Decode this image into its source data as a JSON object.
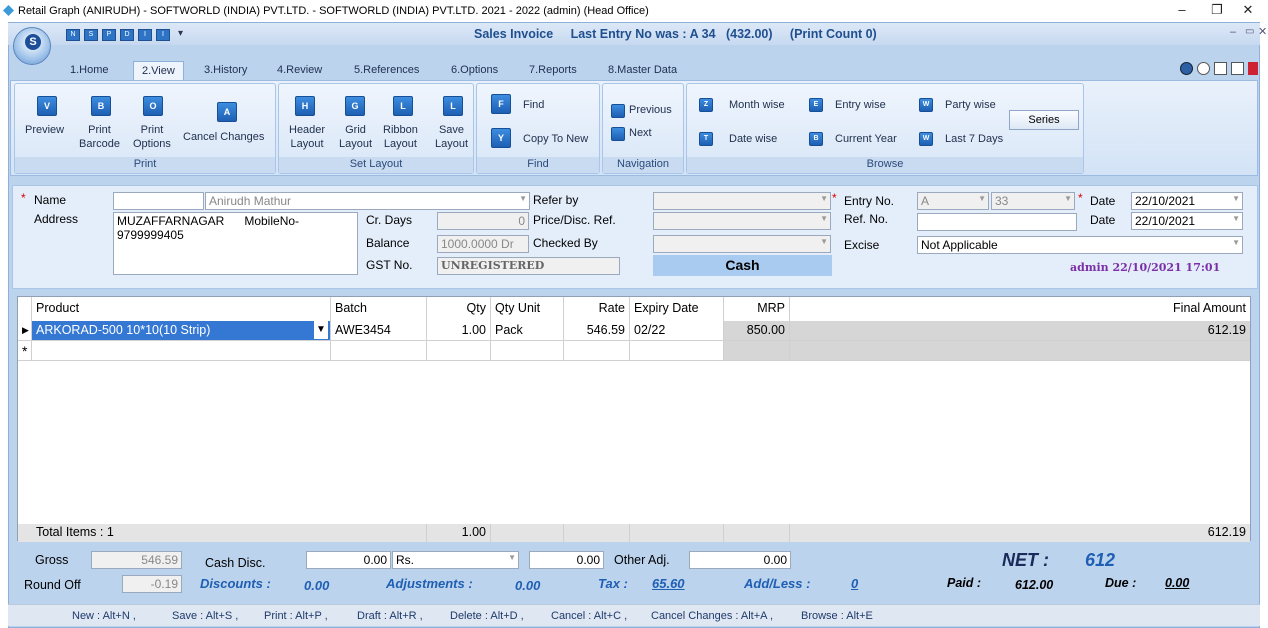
{
  "window": {
    "title": "Retail Graph (ANIRUDH) - SOFTWORLD (INDIA) PVT.LTD. - SOFTWORLD (INDIA) PVT.LTD.  2021 - 2022 (admin) (Head Office)",
    "min": "–",
    "max": "❐",
    "close": "✕"
  },
  "app": {
    "title": "Sales Invoice",
    "last_entry": "Last Entry No was : A 34",
    "amount": "(432.00)",
    "print_count": "(Print Count 0)",
    "orb_letter": "S",
    "qa_icons": [
      "N",
      "S",
      "P",
      "D",
      "I",
      "I"
    ],
    "top_right_icons": [
      "help-icon",
      "globe-icon",
      "calc-icon",
      "window-icon",
      "flag-icon"
    ]
  },
  "tabs": [
    "1.Home",
    "2.View",
    "3.History",
    "4.Review",
    "5.References",
    "6.Options",
    "7.Reports",
    "8.Master Data"
  ],
  "ribbon": {
    "print": {
      "label": "Print",
      "preview": "Preview",
      "print_barcode_1": "Print",
      "print_barcode_2": "Barcode",
      "print_options_1": "Print",
      "print_options_2": "Options",
      "cancel_changes": "Cancel Changes"
    },
    "set_layout": {
      "label": "Set Layout",
      "header_1": "Header",
      "header_2": "Layout",
      "grid_1": "Grid",
      "grid_2": "Layout",
      "ribbon_1": "Ribbon",
      "ribbon_2": "Layout",
      "save_1": "Save",
      "save_2": "Layout"
    },
    "find": {
      "label": "Find",
      "find": "Find",
      "copy_to_new": "Copy To New"
    },
    "navigation": {
      "label": "Navigation",
      "previous": "Previous",
      "next": "Next"
    },
    "browse": {
      "label": "Browse",
      "month_wise": "Month wise",
      "entry_wise": "Entry wise",
      "party_wise": "Party wise",
      "date_wise": "Date wise",
      "current_year": "Current Year",
      "last_7_days": "Last 7 Days",
      "series": "Series"
    }
  },
  "form": {
    "name_label": "Name",
    "name_value": "Anirudh Mathur",
    "address_label": "Address",
    "address_line1": "MUZAFFARNAGAR      MobileNo-",
    "address_line2": "9799999405",
    "cr_days_label": "Cr. Days",
    "cr_days_value": "0",
    "balance_label": "Balance",
    "balance_value": "1000.0000 Dr",
    "gst_label": "GST No.",
    "gst_value": "UNREGISTERED",
    "refer_by_label": "Refer by",
    "price_ref_label": "Price/Disc. Ref.",
    "checked_by_label": "Checked By",
    "cash": "Cash",
    "entry_no_label": "Entry No.",
    "entry_series": "A",
    "entry_no": "33",
    "ref_no_label": "Ref. No.",
    "excise_label": "Excise",
    "excise_value": "Not Applicable",
    "date_label": "Date",
    "date_value": "22/10/2021",
    "date2_label": "Date",
    "date2_value": "22/10/2021",
    "admin_stamp": "admin 22/10/2021 17:01"
  },
  "grid": {
    "headers": {
      "product": "Product",
      "batch": "Batch",
      "qty": "Qty",
      "qty_unit": "Qty Unit",
      "rate": "Rate",
      "expiry": "Expiry Date",
      "mrp": "MRP",
      "final": "Final Amount"
    },
    "row": {
      "product": "ARKORAD-500 10*10(10 Strip)",
      "batch": "AWE3454",
      "qty": "1.00",
      "qty_unit": "Pack",
      "rate": "546.59",
      "expiry": "02/22",
      "mrp": "850.00",
      "final": "612.19"
    },
    "totals": {
      "items": "Total Items : 1",
      "qty": "1.00",
      "final": "612.19"
    }
  },
  "bottom": {
    "gross_label": "Gross",
    "gross_value": "546.59",
    "cash_disc_label": "Cash Disc.",
    "cash_disc_value": "0.00",
    "cash_disc_unit": "Rs.",
    "cash_disc_amount": "0.00",
    "other_adj_label": "Other Adj.",
    "other_adj_value": "0.00",
    "net_label": "NET :",
    "net_value": "612",
    "round_off_label": "Round Off",
    "round_off_value": "-0.19",
    "discounts_label": "Discounts :",
    "discounts_value": "0.00",
    "adjustments_label": "Adjustments :",
    "adjustments_value": "0.00",
    "tax_label": "Tax :",
    "tax_value": "65.60",
    "addless_label": "Add/Less :",
    "addless_value": "0",
    "paid_label": "Paid :",
    "paid_value": "612.00",
    "due_label": "Due :",
    "due_value": "0.00"
  },
  "shortcuts": [
    "New : Alt+N ,",
    "Save : Alt+S ,",
    "Print : Alt+P ,",
    "Draft : Alt+R ,",
    "Delete : Alt+D ,",
    "Cancel : Alt+C ,",
    "Cancel Changes : Alt+A ,",
    "Browse : Alt+E"
  ]
}
